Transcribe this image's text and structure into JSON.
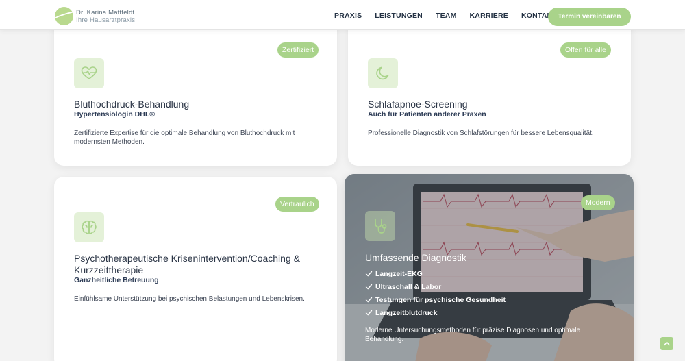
{
  "header": {
    "logo_name": "Dr. Karina Mattfeldt",
    "logo_sub": "Ihre Hausarztpraxis",
    "nav": [
      "PRAXIS",
      "LEISTUNGEN",
      "TEAM",
      "KARRIERE",
      "KONTAKT"
    ],
    "cta": "Termin vereinbaren"
  },
  "cards": [
    {
      "badge": "Zertifiziert",
      "icon": "heart-pulse-icon",
      "title": "Bluthochdruck-Behandlung",
      "subtitle": "Hypertensiologin DHL®",
      "description": "Zertifizierte Expertise für die optimale Behandlung von Bluthochdruck mit modernsten Methoden."
    },
    {
      "badge": "Offen für alle",
      "icon": "moon-icon",
      "title": "Schlafapnoe-Screening",
      "subtitle": "Auch für Patienten anderer Praxen",
      "description": "Professionelle Diagnostik von Schlafstörungen für bessere Lebensqualität."
    },
    {
      "badge": "Vertraulich",
      "icon": "brain-icon",
      "title": "Psychotherapeutische Krisenintervention/Coaching & Kurzzeittherapie",
      "subtitle": "Ganzheitliche Betreuung",
      "description": "Einfühlsame Unterstützung bei psychischen Belastungen und Lebenskrisen."
    },
    {
      "badge": "Modern",
      "icon": "stethoscope-icon",
      "title": "Umfassende Diagnostik",
      "items": [
        "Langzeit-EKG",
        "Ultraschall & Labor",
        "Testungen für psychische Gesundheit",
        "Langzeitblutdruck"
      ],
      "description": "Moderne Untersuchungsmethoden für präzise Diagnosen und optimale Behandlung."
    }
  ],
  "colors": {
    "accent": "#a9d38a",
    "icon_bg": "#e4f1d8",
    "text_dark": "#2c3b55"
  }
}
